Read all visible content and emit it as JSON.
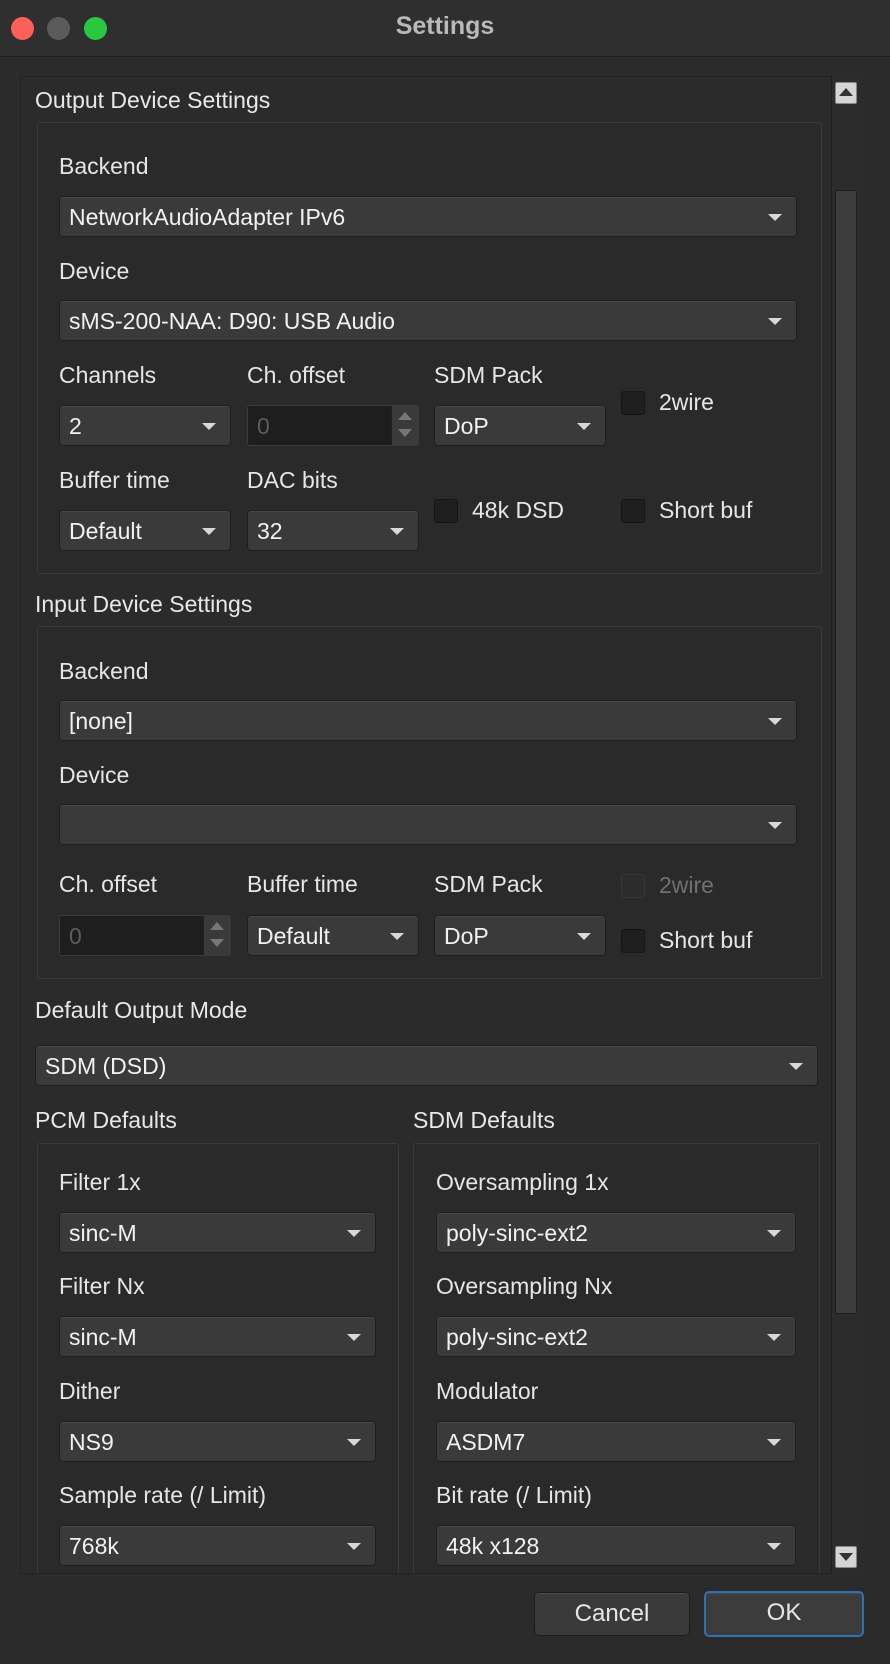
{
  "window": {
    "title": "Settings",
    "traffic_colors": {
      "close": "#fe5f57",
      "minimize": "#5b5b5b",
      "zoom": "#29c840"
    }
  },
  "output": {
    "title": "Output Device Settings",
    "backend_label": "Backend",
    "backend_value": "NetworkAudioAdapter IPv6",
    "device_label": "Device",
    "device_value": "sMS-200-NAA: D90: USB Audio",
    "channels_label": "Channels",
    "channels_value": "2",
    "ch_offset_label": "Ch. offset",
    "ch_offset_value": "0",
    "sdm_pack_label": "SDM Pack",
    "sdm_pack_value": "DoP",
    "twowire_label": "2wire",
    "buffer_time_label": "Buffer time",
    "buffer_time_value": "Default",
    "dac_bits_label": "DAC bits",
    "dac_bits_value": "32",
    "dsd48k_label": "48k DSD",
    "short_buf_label": "Short buf"
  },
  "input": {
    "title": "Input Device Settings",
    "backend_label": "Backend",
    "backend_value": "[none]",
    "device_label": "Device",
    "device_value": "",
    "ch_offset_label": "Ch. offset",
    "ch_offset_value": "0",
    "buffer_time_label": "Buffer time",
    "buffer_time_value": "Default",
    "sdm_pack_label": "SDM Pack",
    "sdm_pack_value": "DoP",
    "twowire_label": "2wire",
    "short_buf_label": "Short buf"
  },
  "default_output": {
    "title": "Default Output Mode",
    "value": "SDM (DSD)"
  },
  "pcm": {
    "title": "PCM Defaults",
    "filter1x_label": "Filter 1x",
    "filter1x_value": "sinc-M",
    "filternx_label": "Filter Nx",
    "filternx_value": "sinc-M",
    "dither_label": "Dither",
    "dither_value": "NS9",
    "samplerate_label": "Sample rate (/ Limit)",
    "samplerate_value": "768k"
  },
  "sdm": {
    "title": "SDM Defaults",
    "os1x_label": "Oversampling 1x",
    "os1x_value": "poly-sinc-ext2",
    "osnx_label": "Oversampling Nx",
    "osnx_value": "poly-sinc-ext2",
    "modulator_label": "Modulator",
    "modulator_value": "ASDM7",
    "bitrate_label": "Bit rate (/ Limit)",
    "bitrate_value": "48k x128"
  },
  "buttons": {
    "cancel": "Cancel",
    "ok": "OK"
  }
}
